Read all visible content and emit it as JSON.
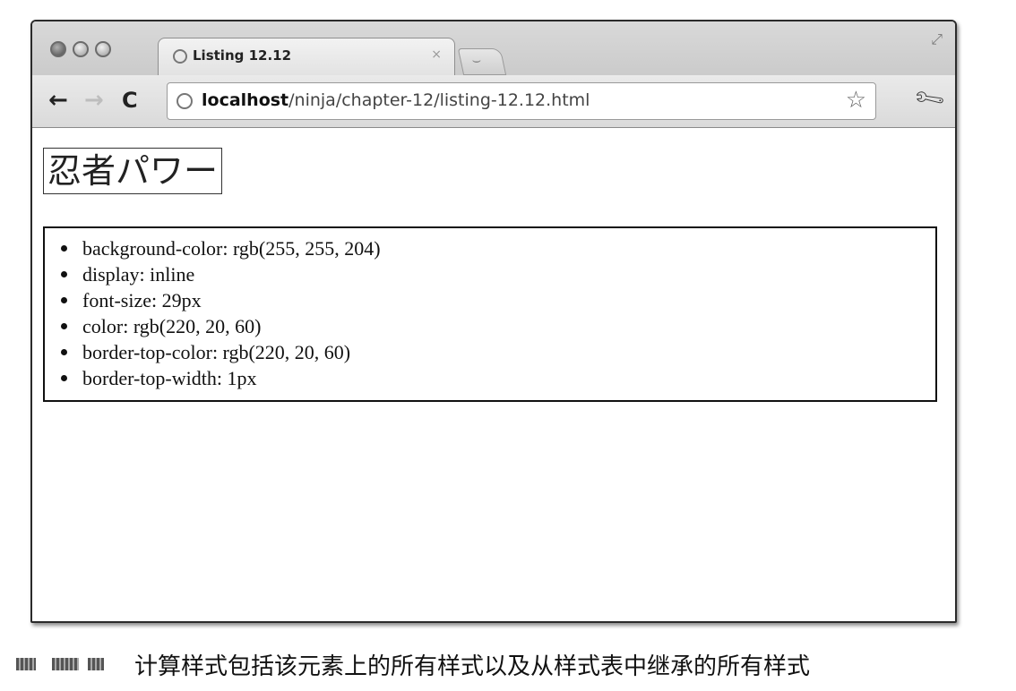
{
  "browser": {
    "tab": {
      "title": "Listing 12.12",
      "close_glyph": "×"
    },
    "address": {
      "host": "localhost",
      "path": "/ninja/chapter-12/listing-12.12.html"
    },
    "icons": {
      "back": "arrow-left-icon",
      "forward": "arrow-right-icon",
      "reload": "reload-icon",
      "bookmark": "star-icon",
      "settings": "wrench-icon",
      "page": "globe-icon",
      "resize": "resize-icon"
    }
  },
  "page": {
    "heading": "忍者パワー",
    "computed_styles": [
      "background-color: rgb(255, 255, 204)",
      "display: inline",
      "font-size: 29px",
      "color: rgb(220, 20, 60)",
      "border-top-color: rgb(220, 20, 60)",
      "border-top-width: 1px"
    ]
  },
  "caption": {
    "text": "计算样式包括该元素上的所有样式以及从样式表中继承的所有样式"
  }
}
